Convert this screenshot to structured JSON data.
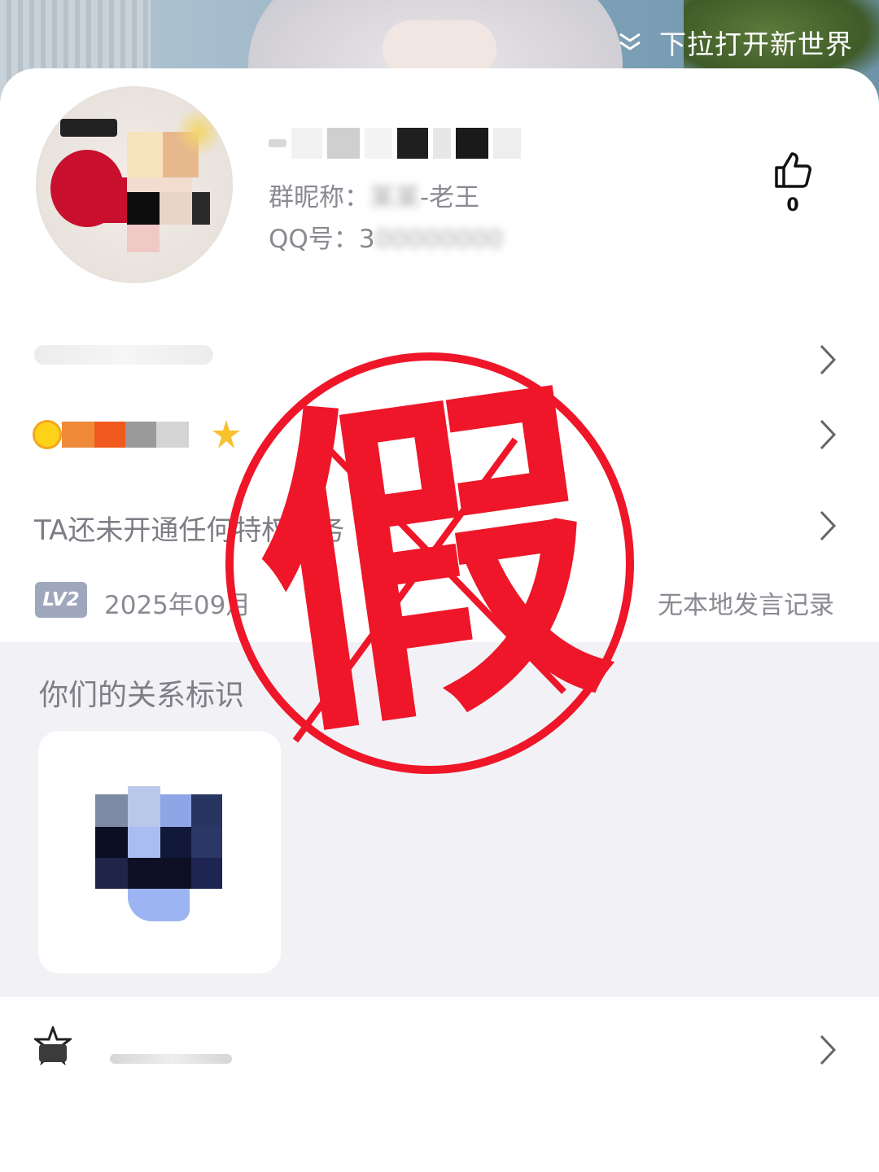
{
  "banner": {
    "hint": "下拉打开新世界"
  },
  "profile": {
    "nickname_label": "群昵称：",
    "nickname_value": "-老王",
    "qq_label": "QQ号：",
    "qq_value": "3",
    "likes": "0"
  },
  "rows": {
    "service_text": "TA还未开通任何特权服务",
    "level_badge": "LV2",
    "join_text": "2025年09月",
    "no_record": "无本地发言记录"
  },
  "relation": {
    "title": "你们的关系标识"
  },
  "stamp": {
    "text": "假",
    "color": "#ee1628"
  },
  "colors": {
    "muted_text": "#8a8a93",
    "section_bg": "#f2f2f6",
    "badge_bg": "#9fa7bd"
  }
}
